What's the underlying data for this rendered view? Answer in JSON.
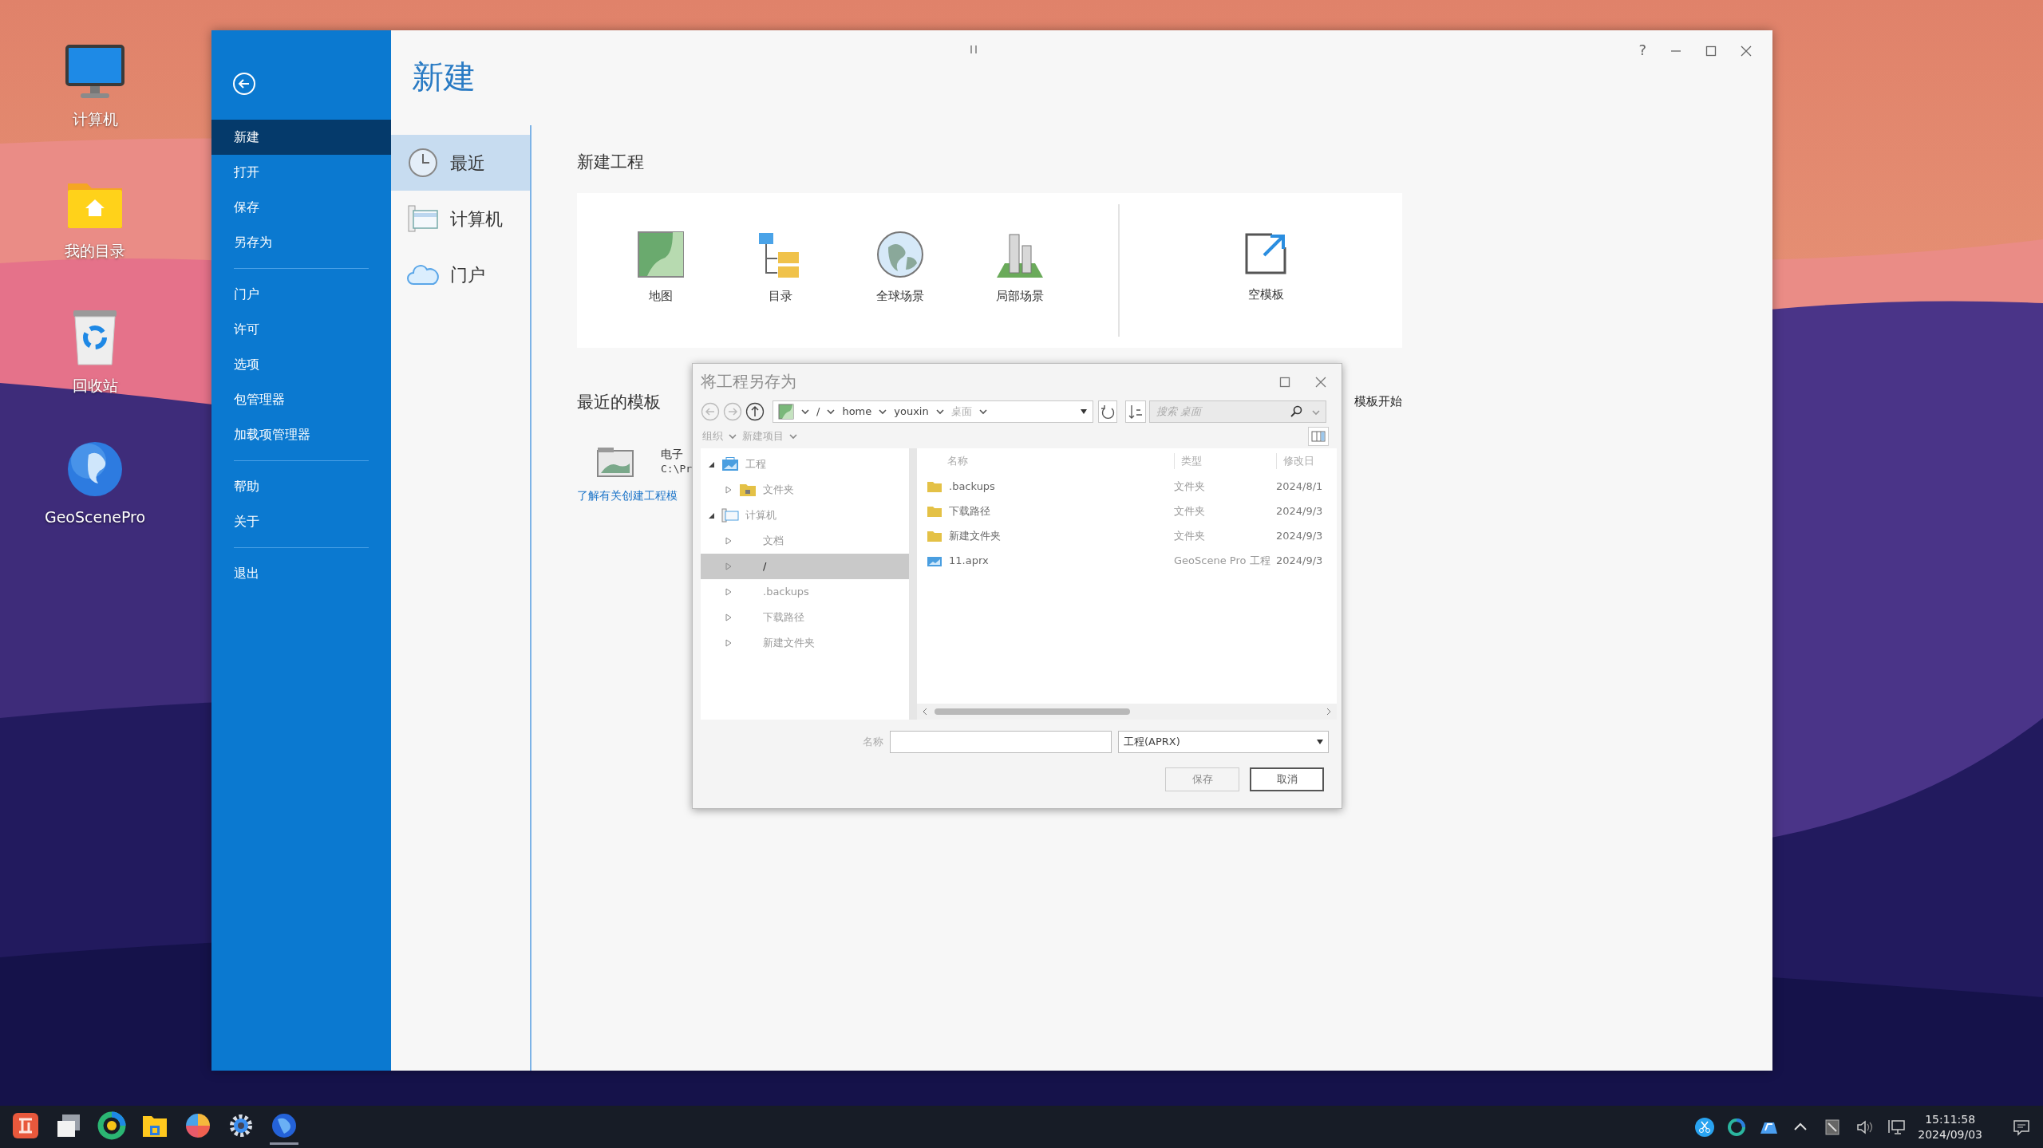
{
  "desktop_icons": [
    {
      "label": "计算机",
      "kind": "monitor"
    },
    {
      "label": "我的目录",
      "kind": "home-folder"
    },
    {
      "label": "回收站",
      "kind": "trash"
    },
    {
      "label": "GeoScenePro",
      "kind": "globe"
    }
  ],
  "app_window": {
    "title": "新建",
    "help": "?",
    "menu_groups": [
      [
        {
          "label": "新建",
          "selected": true
        },
        {
          "label": "打开",
          "selected": false
        },
        {
          "label": "保存",
          "selected": false
        },
        {
          "label": "另存为",
          "selected": false
        }
      ],
      [
        {
          "label": "门户",
          "selected": false
        },
        {
          "label": "许可",
          "selected": false
        },
        {
          "label": "选项",
          "selected": false
        },
        {
          "label": "包管理器",
          "selected": false
        },
        {
          "label": "加载项管理器",
          "selected": false
        }
      ],
      [
        {
          "label": "帮助",
          "selected": false
        },
        {
          "label": "关于",
          "selected": false
        }
      ],
      [
        {
          "label": "退出",
          "selected": false
        }
      ]
    ],
    "locations": [
      {
        "label": "最近",
        "kind": "clock",
        "selected": true
      },
      {
        "label": "计算机",
        "kind": "computer",
        "selected": false
      },
      {
        "label": "门户",
        "kind": "cloud",
        "selected": false
      }
    ],
    "new_project": {
      "heading": "新建工程",
      "templates": [
        {
          "label": "地图",
          "kind": "map"
        },
        {
          "label": "目录",
          "kind": "catalog"
        },
        {
          "label": "全球场景",
          "kind": "global-scene"
        },
        {
          "label": "局部场景",
          "kind": "local-scene"
        }
      ],
      "blank": {
        "label": "空模板"
      }
    },
    "recent_templates": {
      "heading": "最近的模板",
      "side_text": "模板开始",
      "items": [
        {
          "name": "电子",
          "path": "C:\\Pr"
        }
      ],
      "link": "了解有关创建工程模"
    }
  },
  "save_dialog": {
    "title": "将工程另存为",
    "address": [
      "/",
      "home",
      "youxin",
      "桌面"
    ],
    "search_placeholder": "搜索 桌面",
    "toolbar": [
      "组织",
      "新建项目"
    ],
    "tree": [
      {
        "label": "工程",
        "kind": "project",
        "expanded": true,
        "selected": false,
        "children": [
          {
            "label": "文件夹",
            "kind": "folder",
            "expanded": false,
            "selected": false
          }
        ]
      },
      {
        "label": "计算机",
        "kind": "computer",
        "expanded": true,
        "selected": false,
        "children": [
          {
            "label": "文档",
            "kind": "plain",
            "expanded": false,
            "selected": false
          },
          {
            "label": "/",
            "kind": "plain",
            "expanded": false,
            "selected": true
          },
          {
            "label": ".backups",
            "kind": "plain",
            "expanded": false,
            "selected": false
          },
          {
            "label": "下载路径",
            "kind": "plain",
            "expanded": false,
            "selected": false
          },
          {
            "label": "新建文件夹",
            "kind": "plain",
            "expanded": false,
            "selected": false
          }
        ]
      }
    ],
    "columns": [
      "名称",
      "类型",
      "修改日"
    ],
    "files": [
      {
        "name": ".backups",
        "type": "文件夹",
        "modified": "2024/8/1",
        "kind": "folder"
      },
      {
        "name": "下载路径",
        "type": "文件夹",
        "modified": "2024/9/3",
        "kind": "folder"
      },
      {
        "name": "新建文件夹",
        "type": "文件夹",
        "modified": "2024/9/3",
        "kind": "folder"
      },
      {
        "name": "11.aprx",
        "type": "GeoScene Pro 工程",
        "modified": "2024/9/3",
        "kind": "project"
      }
    ],
    "name_label": "名称",
    "file_type": "工程(APRX)",
    "buttons": [
      {
        "label": "保存",
        "disabled": true
      },
      {
        "label": "取消",
        "disabled": false
      }
    ]
  },
  "taskbar": {
    "apps": [
      {
        "kind": "red-app",
        "active": false
      },
      {
        "kind": "windows",
        "active": false
      },
      {
        "kind": "browser",
        "active": false
      },
      {
        "kind": "files",
        "active": false
      },
      {
        "kind": "pinwheel",
        "active": false
      },
      {
        "kind": "settings",
        "active": false
      },
      {
        "kind": "globe",
        "active": true
      }
    ],
    "tray": [
      {
        "kind": "scissors"
      },
      {
        "kind": "ring"
      },
      {
        "kind": "cloud"
      },
      {
        "kind": "caret"
      },
      {
        "kind": "input"
      },
      {
        "kind": "volume"
      },
      {
        "kind": "network"
      }
    ],
    "time": "15:11:58",
    "date": "2024/09/03"
  }
}
